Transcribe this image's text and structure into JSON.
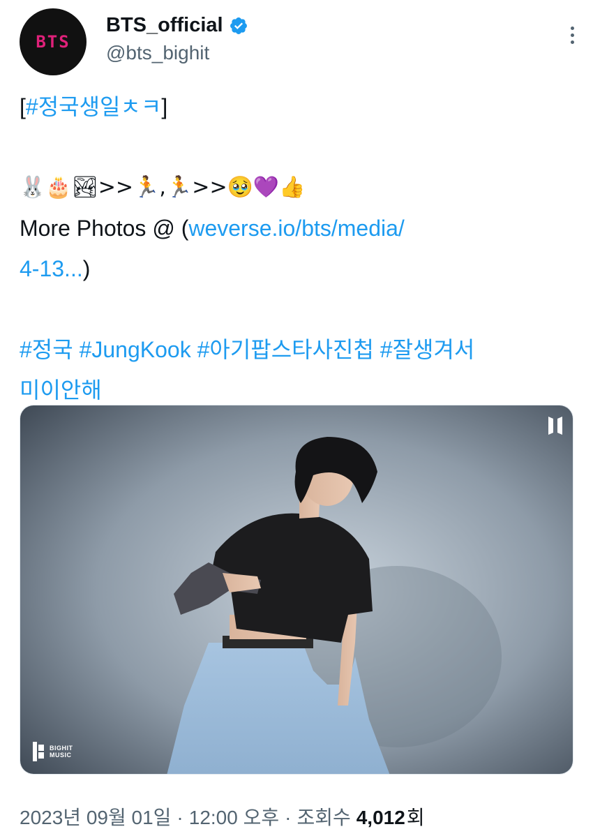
{
  "author": {
    "avatar_text": "BTS",
    "display_name": "BTS_official",
    "handle": "@bts_bighit",
    "verified_icon": "verified-badge-icon",
    "more_icon": "more-vertical-icon"
  },
  "tweet": {
    "hashtag_line": "[#정국생일ㅊㅋ]",
    "emoji_line": "🐰🎂🏞>>🏃,🏃>>🥹💜👍",
    "more_photos_prefix": "More Photos @ (",
    "link_part1": "weverse.io/bts/media/",
    "link_part2": "4-13...",
    "link_suffix": ")",
    "tags_line1": "#정국 #JungKook #아기팝스타사진첩 #잘생겨서",
    "tags_line2": "미이안해"
  },
  "media": {
    "brand_icon": "bts-logo-icon",
    "watermark_icon": "bighit-music-logo-icon",
    "watermark_label_1": "BIGHIT",
    "watermark_label_2": "MUSIC"
  },
  "meta": {
    "date": "2023년 09월 01일",
    "separator": "·",
    "time": "12:00 오후",
    "views_label": "조회수",
    "views_count": "4,012",
    "views_unit": "회"
  },
  "colors": {
    "link": "#1d9bf0",
    "text": "#0f1419",
    "secondary": "#536471",
    "avatar_bg": "#111111",
    "avatar_text": "#e0217a"
  }
}
